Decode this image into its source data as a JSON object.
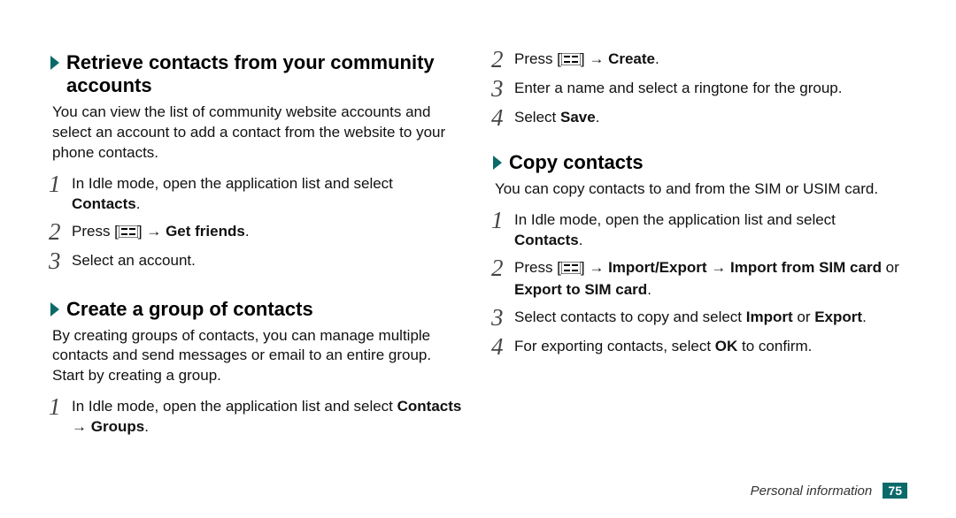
{
  "left": {
    "sec1": {
      "title": "Retrieve contacts from your community accounts",
      "intro": "You can view the list of community website accounts and select an account to add a contact from the website to your phone contacts.",
      "steps": {
        "s1": {
          "num": "1",
          "a": "In Idle mode, open the application list and select ",
          "b": "Contacts",
          "c": "."
        },
        "s2": {
          "num": "2",
          "a": "Press [",
          "b": "] → ",
          "c": "Get friends",
          "d": "."
        },
        "s3": {
          "num": "3",
          "a": "Select an account."
        }
      }
    },
    "sec2": {
      "title": "Create a group of contacts",
      "intro": "By creating groups of contacts, you can manage multiple contacts and send messages or email to an entire group. Start by creating a group.",
      "steps": {
        "s1": {
          "num": "1",
          "a": "In Idle mode, open the application list and select ",
          "b": "Contacts",
          "c": " → ",
          "d": "Groups",
          "e": "."
        }
      }
    }
  },
  "right": {
    "sec2cont": {
      "s2": {
        "num": "2",
        "a": "Press [",
        "b": "] → ",
        "c": "Create",
        "d": "."
      },
      "s3": {
        "num": "3",
        "a": "Enter a name and select a ringtone for the group."
      },
      "s4": {
        "num": "4",
        "a": "Select ",
        "b": "Save",
        "c": "."
      }
    },
    "sec3": {
      "title": "Copy contacts",
      "intro": "You can copy contacts to and from the SIM or USIM card.",
      "steps": {
        "s1": {
          "num": "1",
          "a": "In Idle mode, open the application list and select ",
          "b": "Contacts",
          "c": "."
        },
        "s2": {
          "num": "2",
          "a": "Press [",
          "b": "] → ",
          "c": "Import/Export",
          "d": " → ",
          "e": "Import from SIM card",
          "f": " or ",
          "g": "Export to SIM card",
          "h": "."
        },
        "s3": {
          "num": "3",
          "a": "Select contacts to copy and select ",
          "b": "Import",
          "c": " or ",
          "d": "Export",
          "e": "."
        },
        "s4": {
          "num": "4",
          "a": "For exporting contacts, select ",
          "b": "OK",
          "c": " to confirm."
        }
      }
    }
  },
  "footer": {
    "text": "Personal information",
    "page": "75"
  }
}
